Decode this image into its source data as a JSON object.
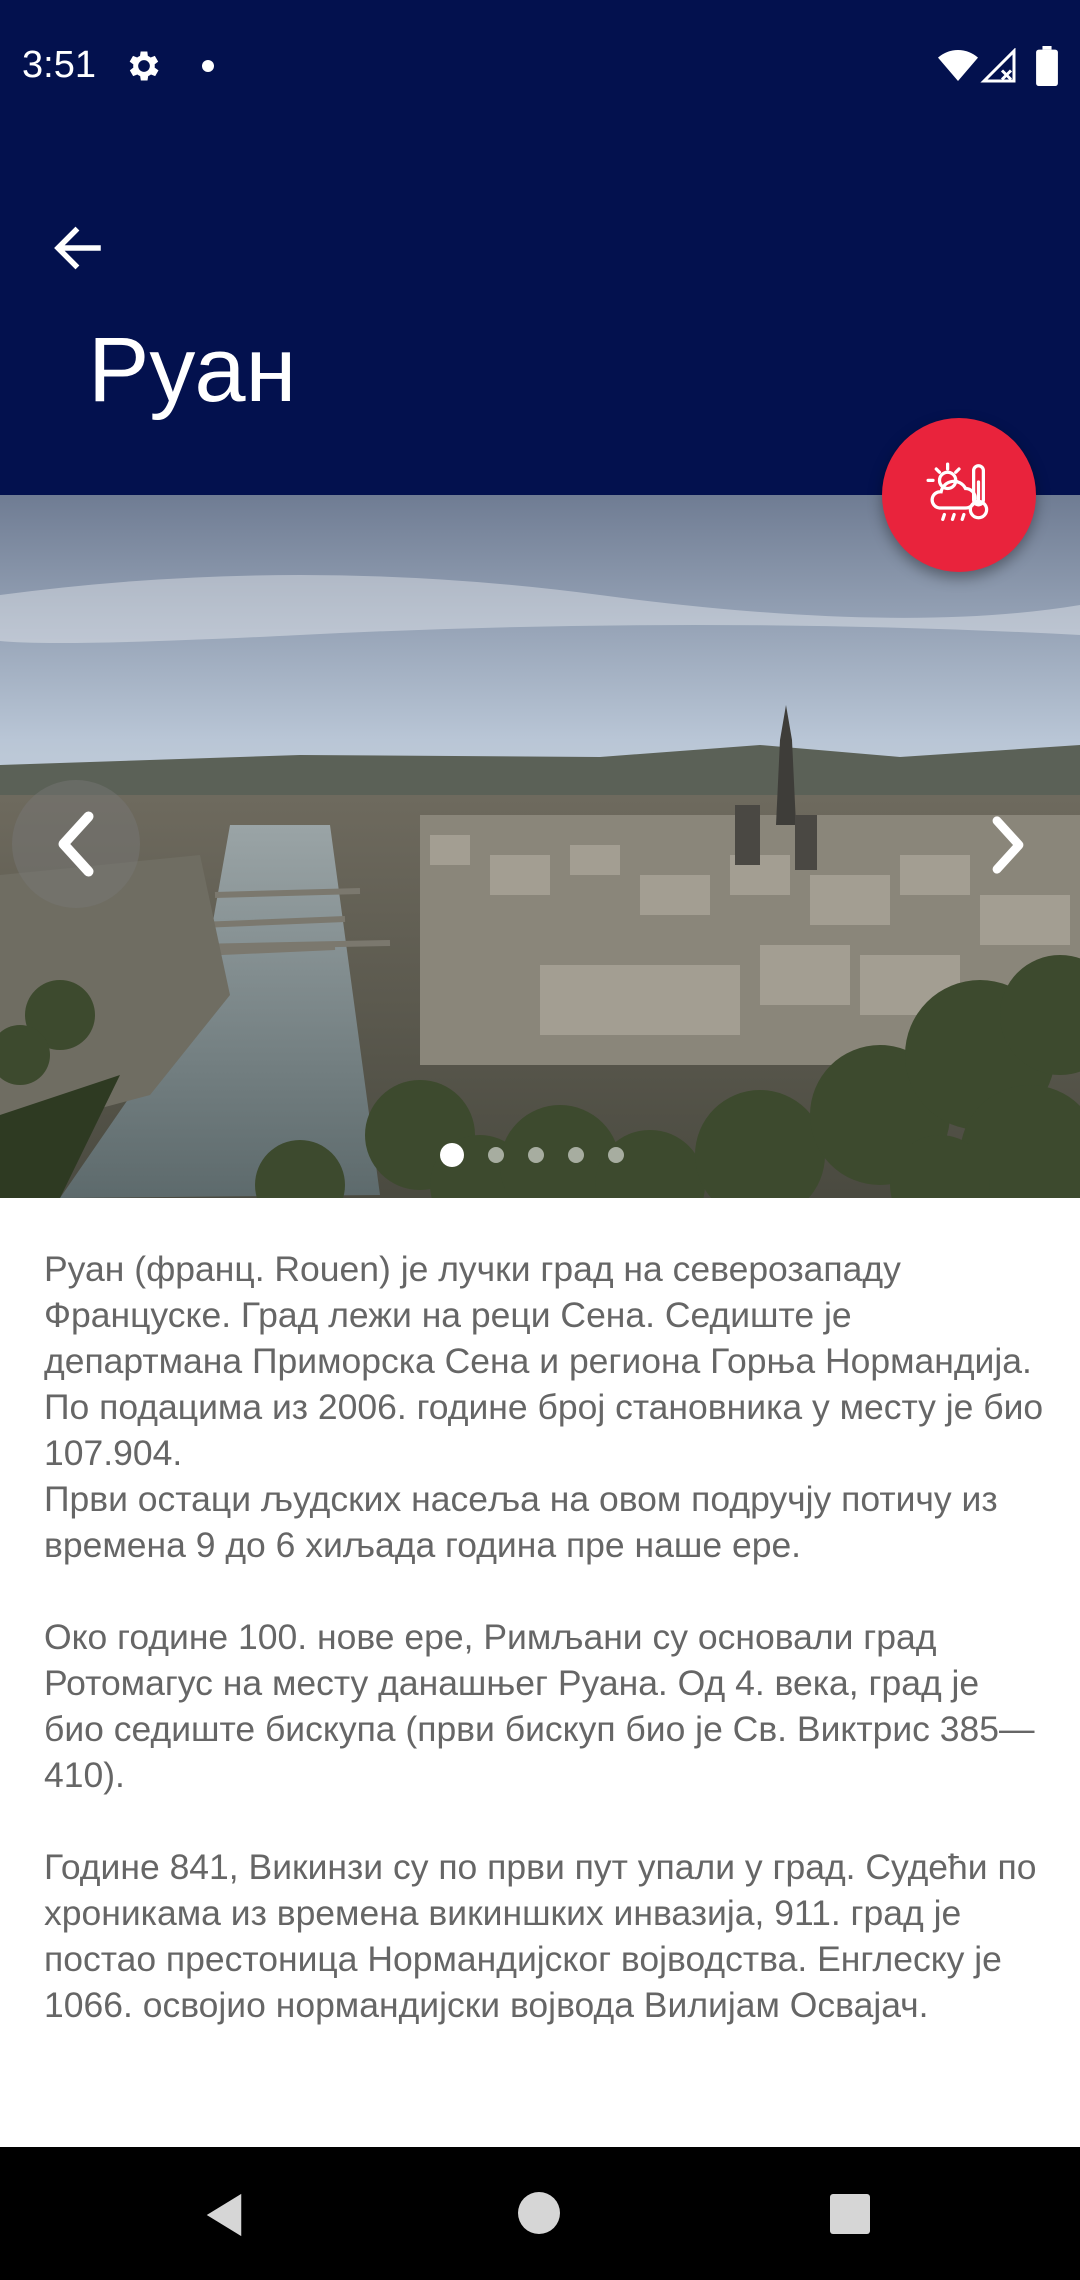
{
  "status_bar": {
    "time": "3:51",
    "icons": [
      "gear-icon",
      "notification-dot-icon",
      "wifi-icon",
      "signal-icon",
      "battery-icon"
    ]
  },
  "app_bar": {
    "title": "Руан",
    "background_color": "#03114e",
    "back_icon": "arrow-left-icon"
  },
  "fab": {
    "icon": "weather-cloud-thermometer-icon",
    "color": "#e9233c"
  },
  "gallery": {
    "image_description_icon": "city-photo",
    "prev_icon": "chevron-left-icon",
    "next_icon": "chevron-right-icon",
    "page_count": 5,
    "active_page": 1
  },
  "article": {
    "paragraphs": [
      "Руан (франц. Rouen) је лучки град на северозападу Француске. Град лежи на реци Сена. Седиште је департмана Приморска Сена и региона Горња Нормандија. По подацима из 2006. године број становника у месту је био 107.904.\nПрви остаци људских насеља на овом подручју потичу из времена 9 до 6 хиљада година пре наше ере.",
      "Око године 100. нове ере, Римљани су основали град Ротомагус на месту данашњег Руана. Од 4. века, град је био седиште бискупа (први бискуп био је Св. Виктрис 385—410).",
      "Године 841, Викинзи су по први пут упали у град. Судећи по хроникама из времена викиншких инвазија, 911. град је постао престоница Нормандијског војводства. Енглеску је 1066. освојио нормандијски војвода Вилијам Освајач."
    ]
  },
  "nav_bar": {
    "icons": [
      "back-triangle-icon",
      "home-circle-icon",
      "recents-square-icon"
    ]
  }
}
